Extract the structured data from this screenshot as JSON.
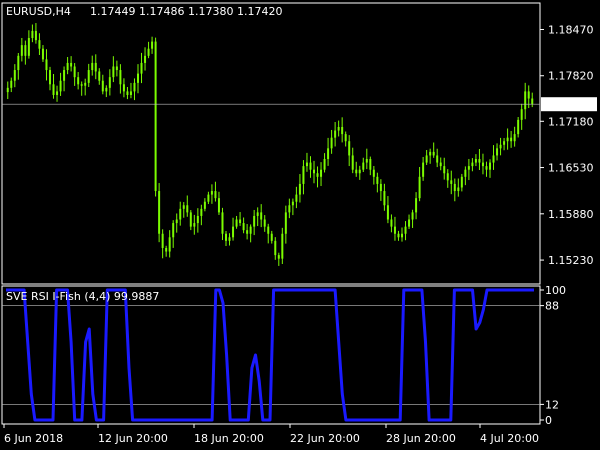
{
  "header": {
    "symbol_tf": "EURUSD,H4",
    "ohlc": "1.17449 1.17486 1.17380 1.17420"
  },
  "indicator": {
    "caption": "SVE RSI I-Fish (4,4) 99.9887",
    "levels": [
      12,
      88
    ],
    "scale_labels": [
      "100",
      "88",
      "12",
      "0"
    ]
  },
  "colors": {
    "background": "#000000",
    "frame": "#ffffff",
    "candle_up": "#7CFC00",
    "candle_down": "#7CFC00",
    "indicator_line": "#1a1aff",
    "level_line": "#c0c0c0",
    "bid_line": "#c0c0c0",
    "price_tag_bg": "#ffffff",
    "price_tag_text": "#000000"
  },
  "chart_data": [
    {
      "type": "candlestick",
      "title": "EURUSD,H4",
      "y_ticks": [
        "1.18470",
        "1.17820",
        "1.17180",
        "1.16530",
        "1.15880",
        "1.15230"
      ],
      "ylim": [
        1.1495,
        1.188
      ],
      "current_price": "1.17420",
      "x_ticks": [
        "6 Jun 2018",
        "12 Jun 20:00",
        "18 Jun 20:00",
        "22 Jun 20:00",
        "28 Jun 20:00",
        "4 Jul 20:00"
      ],
      "close": [
        1.1765,
        1.1775,
        1.179,
        1.181,
        1.1825,
        1.181,
        1.1835,
        1.1845,
        1.1832,
        1.182,
        1.1805,
        1.179,
        1.177,
        1.1755,
        1.176,
        1.1775,
        1.179,
        1.18,
        1.1795,
        1.178,
        1.177,
        1.1768,
        1.1772,
        1.179,
        1.18,
        1.1788,
        1.1775,
        1.176,
        1.1765,
        1.178,
        1.1795,
        1.179,
        1.177,
        1.176,
        1.1755,
        1.176,
        1.1772,
        1.1785,
        1.18,
        1.181,
        1.182,
        1.183,
        1.162,
        1.156,
        1.154,
        1.1535,
        1.1555,
        1.1575,
        1.158,
        1.1595,
        1.16,
        1.159,
        1.157,
        1.1575,
        1.1585,
        1.1595,
        1.1605,
        1.1615,
        1.162,
        1.161,
        1.159,
        1.156,
        1.155,
        1.1555,
        1.157,
        1.158,
        1.1575,
        1.1565,
        1.156,
        1.157,
        1.1585,
        1.159,
        1.158,
        1.157,
        1.156,
        1.155,
        1.153,
        1.1525,
        1.156,
        1.159,
        1.16,
        1.1605,
        1.1615,
        1.163,
        1.1655,
        1.166,
        1.165,
        1.1645,
        1.164,
        1.165,
        1.1665,
        1.168,
        1.1695,
        1.1705,
        1.171,
        1.17,
        1.169,
        1.167,
        1.165,
        1.1645,
        1.165,
        1.166,
        1.1665,
        1.165,
        1.164,
        1.163,
        1.162,
        1.16,
        1.158,
        1.157,
        1.156,
        1.1555,
        1.156,
        1.157,
        1.158,
        1.159,
        1.161,
        1.164,
        1.166,
        1.167,
        1.1675,
        1.167,
        1.166,
        1.1655,
        1.1645,
        1.1635,
        1.163,
        1.162,
        1.1625,
        1.164,
        1.165,
        1.1655,
        1.166,
        1.1665,
        1.166,
        1.1655,
        1.165,
        1.166,
        1.167,
        1.168,
        1.1685,
        1.169,
        1.1695,
        1.169,
        1.17,
        1.172,
        1.1735,
        1.176,
        1.175,
        1.1742
      ]
    },
    {
      "type": "line",
      "title": "SVE RSI I-Fish (4,4) 99.9887",
      "series": [
        {
          "name": "SVE RSI I-Fish (4,4)",
          "values": [
            100,
            100,
            100,
            100,
            100,
            100,
            60,
            20,
            0,
            0,
            0,
            0,
            0,
            0,
            100,
            100,
            100,
            100,
            60,
            0,
            0,
            0,
            60,
            70,
            20,
            0,
            0,
            0,
            100,
            100,
            100,
            100,
            100,
            100,
            40,
            0,
            0,
            0,
            0,
            0,
            0,
            0,
            0,
            0,
            0,
            0,
            0,
            0,
            0,
            0,
            0,
            0,
            0,
            0,
            0,
            0,
            0,
            0,
            100,
            100,
            90,
            50,
            0,
            0,
            0,
            0,
            0,
            0,
            40,
            50,
            30,
            0,
            0,
            0,
            100,
            100,
            100,
            100,
            100,
            100,
            100,
            100,
            100,
            100,
            100,
            100,
            100,
            100,
            100,
            100,
            100,
            100,
            60,
            20,
            0,
            0,
            0,
            0,
            0,
            0,
            0,
            0,
            0,
            0,
            0,
            0,
            0,
            0,
            0,
            0,
            100,
            100,
            100,
            100,
            100,
            100,
            60,
            0,
            0,
            0,
            0,
            0,
            0,
            0,
            100,
            100,
            100,
            100,
            100,
            100,
            70,
            75,
            85,
            100,
            100,
            100,
            100,
            100,
            100,
            100,
            100,
            100,
            100,
            100,
            100,
            100,
            100
          ]
        }
      ],
      "y_ticks": [
        "100",
        "88",
        "12",
        "0"
      ],
      "ylim": [
        0,
        100
      ],
      "levels": [
        12,
        88
      ]
    }
  ]
}
